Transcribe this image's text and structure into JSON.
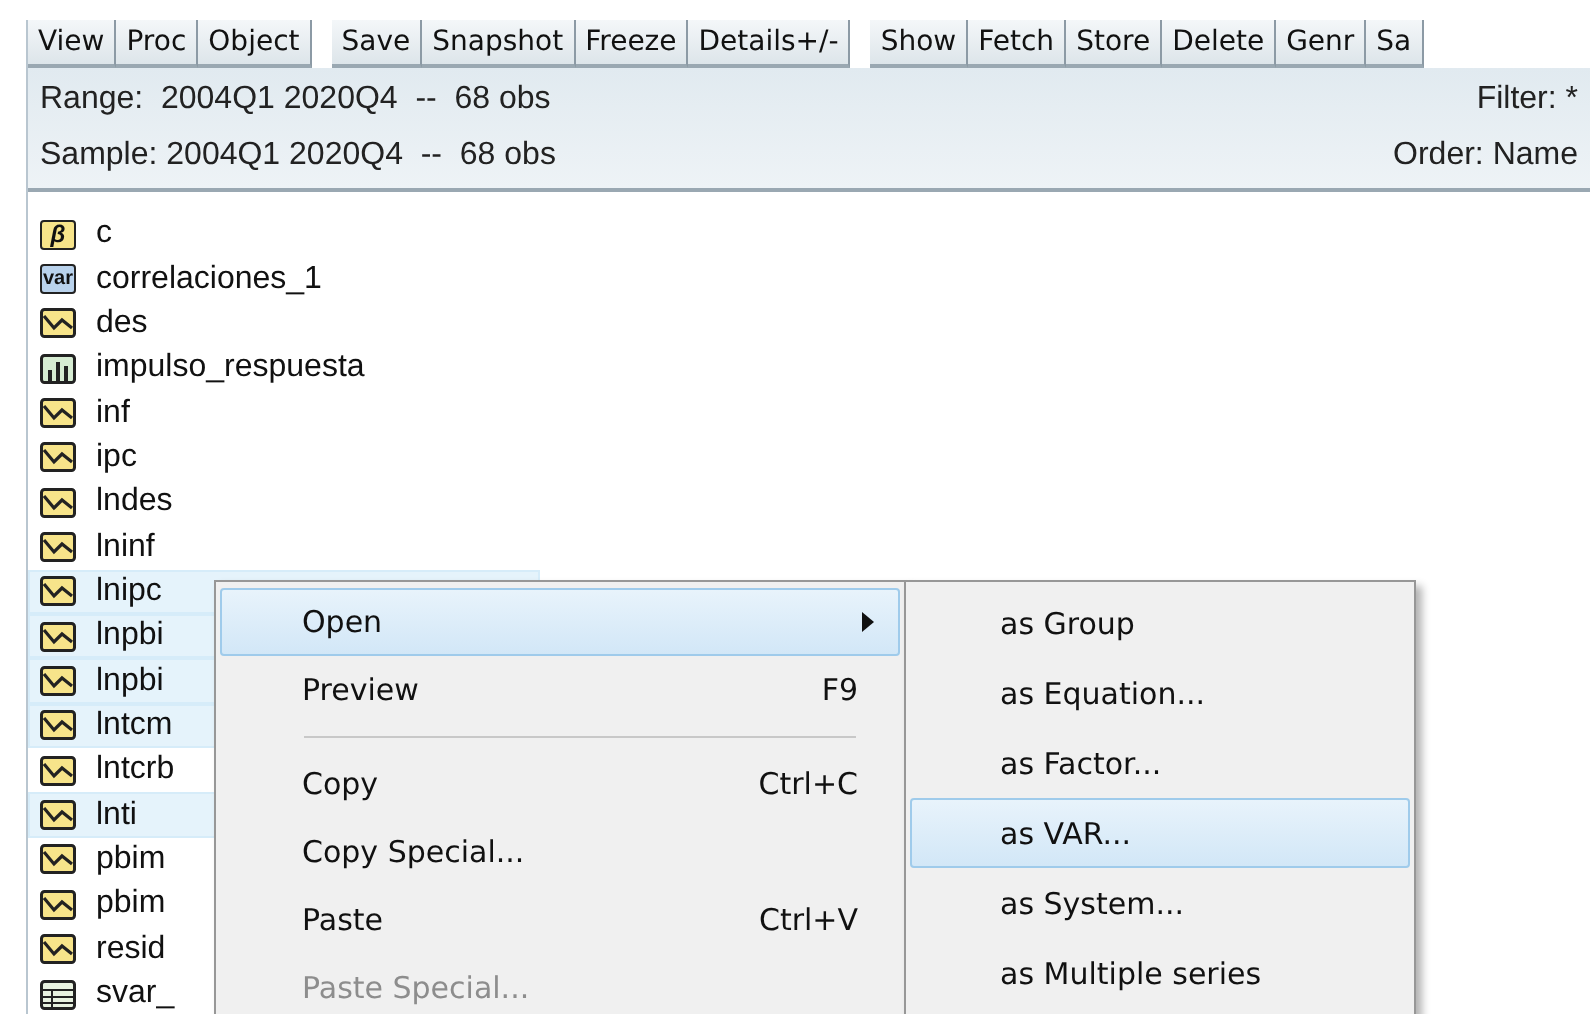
{
  "toolbar": [
    [
      "View",
      "Proc",
      "Object"
    ],
    [
      "Save",
      "Snapshot",
      "Freeze",
      "Details+/-"
    ],
    [
      "Show",
      "Fetch",
      "Store",
      "Delete",
      "Genr",
      "Sa"
    ]
  ],
  "info": {
    "range": "Range:  2004Q1 2020Q4  --  68 obs",
    "sample": "Sample: 2004Q1 2020Q4  --  68 obs",
    "filter": "Filter: *",
    "order": "Order: Name"
  },
  "objects": [
    {
      "name": "c",
      "kind": "coef",
      "badge": "β",
      "selected": false
    },
    {
      "name": "correlaciones_1",
      "kind": "var",
      "badge": "var",
      "selected": false
    },
    {
      "name": "des",
      "kind": "series",
      "selected": false
    },
    {
      "name": "impulso_respuesta",
      "kind": "graph",
      "selected": false
    },
    {
      "name": "inf",
      "kind": "series",
      "selected": false
    },
    {
      "name": "ipc",
      "kind": "series",
      "selected": false
    },
    {
      "name": "lndes",
      "kind": "series",
      "selected": false
    },
    {
      "name": "lninf",
      "kind": "series",
      "selected": false
    },
    {
      "name": "lnipc",
      "kind": "series",
      "selected": true
    },
    {
      "name": "lnpbi",
      "kind": "series",
      "selected": true
    },
    {
      "name": "lnpbi",
      "kind": "series",
      "selected": true
    },
    {
      "name": "lntcm",
      "kind": "series",
      "selected": true
    },
    {
      "name": "lntcrb",
      "kind": "series",
      "selected": false
    },
    {
      "name": "lnti",
      "kind": "series",
      "selected": true
    },
    {
      "name": "pbim",
      "kind": "series",
      "selected": false
    },
    {
      "name": "pbim",
      "kind": "series",
      "selected": false
    },
    {
      "name": "resid",
      "kind": "series",
      "selected": false
    },
    {
      "name": "svar_",
      "kind": "table",
      "selected": false
    }
  ],
  "context_menu": [
    {
      "kind": "item",
      "label": "Open",
      "submenu": true,
      "selected": true,
      "disabled": false
    },
    {
      "kind": "item",
      "label": "Preview",
      "shortcut": "F9",
      "submenu": false,
      "selected": false,
      "disabled": false
    },
    {
      "kind": "separator"
    },
    {
      "kind": "item",
      "label": "Copy",
      "shortcut": "Ctrl+C",
      "submenu": false,
      "selected": false,
      "disabled": false
    },
    {
      "kind": "item",
      "label": "Copy Special...",
      "submenu": false,
      "selected": false,
      "disabled": false
    },
    {
      "kind": "item",
      "label": "Paste",
      "shortcut": "Ctrl+V",
      "submenu": false,
      "selected": false,
      "disabled": false
    },
    {
      "kind": "item",
      "label": "Paste Special...",
      "submenu": false,
      "selected": false,
      "disabled": true
    }
  ],
  "submenu": [
    {
      "label": "as Group",
      "selected": false
    },
    {
      "label": "as Equation...",
      "selected": false
    },
    {
      "label": "as Factor...",
      "selected": false
    },
    {
      "label": "as VAR...",
      "selected": true
    },
    {
      "label": "as System...",
      "selected": false
    },
    {
      "label": "as Multiple series",
      "selected": false
    }
  ]
}
